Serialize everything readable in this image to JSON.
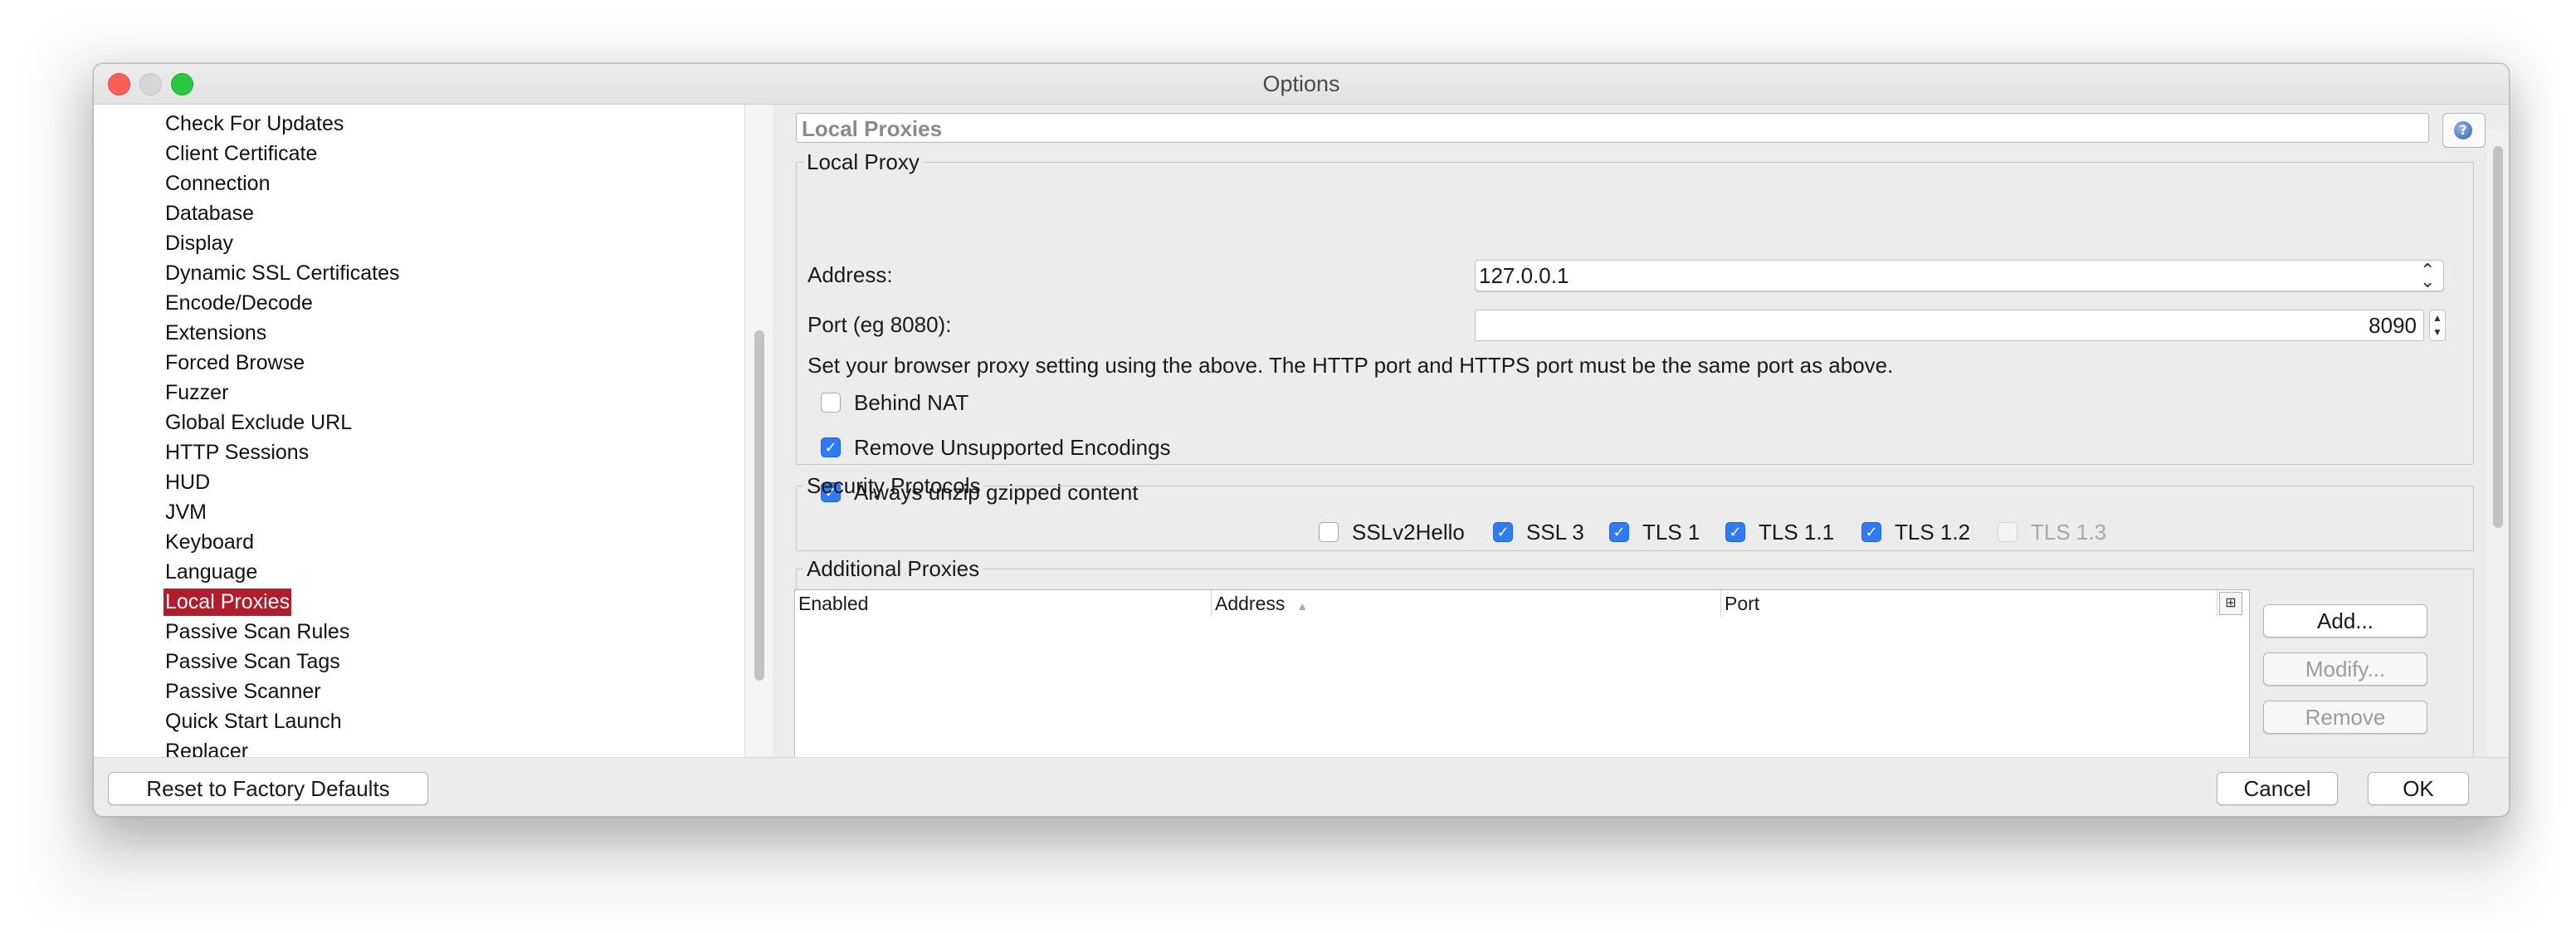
{
  "window": {
    "title": "Options"
  },
  "sidebar": {
    "items": [
      {
        "label": "Check For Updates"
      },
      {
        "label": "Client Certificate"
      },
      {
        "label": "Connection"
      },
      {
        "label": "Database"
      },
      {
        "label": "Display"
      },
      {
        "label": "Dynamic SSL Certificates"
      },
      {
        "label": "Encode/Decode"
      },
      {
        "label": "Extensions"
      },
      {
        "label": "Forced Browse"
      },
      {
        "label": "Fuzzer"
      },
      {
        "label": "Global Exclude URL"
      },
      {
        "label": "HTTP Sessions"
      },
      {
        "label": "HUD"
      },
      {
        "label": "JVM"
      },
      {
        "label": "Keyboard"
      },
      {
        "label": "Language"
      },
      {
        "label": "Local Proxies",
        "selected": true
      },
      {
        "label": "Passive Scan Rules"
      },
      {
        "label": "Passive Scan Tags"
      },
      {
        "label": "Passive Scanner"
      },
      {
        "label": "Quick Start Launch"
      },
      {
        "label": "Replacer"
      }
    ]
  },
  "panel": {
    "title": "Local Proxies",
    "local_proxy": {
      "legend": "Local Proxy",
      "address_label": "Address:",
      "address_value": "127.0.0.1",
      "port_label": "Port (eg 8080):",
      "port_value": "8090",
      "hint": "Set your browser proxy setting using the above.  The HTTP port and HTTPS port must be the same port as above.",
      "behind_nat": {
        "label": "Behind NAT",
        "checked": false
      },
      "remove_unsupported": {
        "label": "Remove Unsupported Encodings",
        "checked": true
      },
      "always_unzip": {
        "label": "Always unzip gzipped content",
        "checked": true
      }
    },
    "security_protocols": {
      "legend": "Security Protocols",
      "items": [
        {
          "label": "SSLv2Hello",
          "checked": false,
          "enabled": true
        },
        {
          "label": "SSL 3",
          "checked": true,
          "enabled": true
        },
        {
          "label": "TLS 1",
          "checked": true,
          "enabled": true
        },
        {
          "label": "TLS 1.1",
          "checked": true,
          "enabled": true
        },
        {
          "label": "TLS 1.2",
          "checked": true,
          "enabled": true
        },
        {
          "label": "TLS 1.3",
          "checked": false,
          "enabled": false
        }
      ]
    },
    "additional_proxies": {
      "legend": "Additional Proxies",
      "columns": [
        "Enabled",
        "Address",
        "Port"
      ],
      "rows": [],
      "add_label": "Add...",
      "modify_label": "Modify...",
      "remove_label": "Remove"
    }
  },
  "footer": {
    "reset_label": "Reset to Factory Defaults",
    "cancel_label": "Cancel",
    "ok_label": "OK"
  },
  "colors": {
    "selection": "#b31c2a",
    "checkbox_on": "#2f7bf6",
    "close": "#fe5f57",
    "maximize": "#28c840"
  },
  "icons": {
    "help": "help-icon",
    "sort": "sort-ascending-icon",
    "column_control": "column-chooser-icon"
  }
}
